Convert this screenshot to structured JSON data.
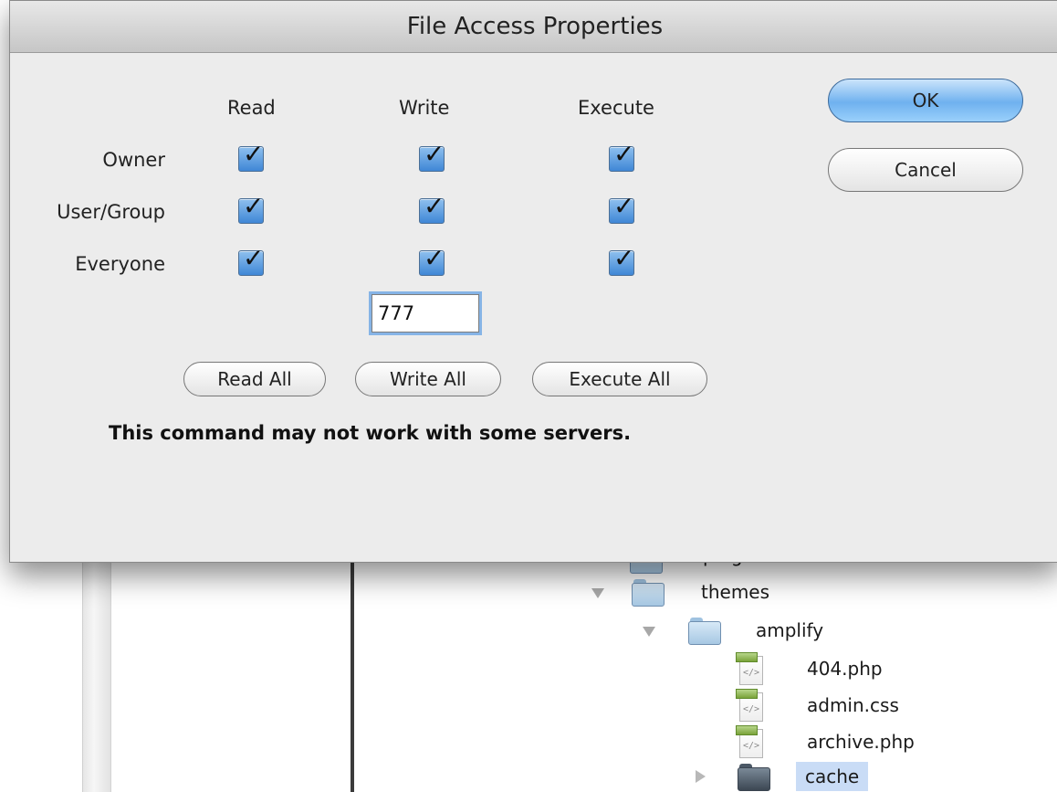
{
  "dialog": {
    "title": "File Access Properties",
    "columns": [
      "Read",
      "Write",
      "Execute"
    ],
    "rows": [
      {
        "label": "Owner",
        "read": true,
        "write": true,
        "execute": true
      },
      {
        "label": "User/Group",
        "read": true,
        "write": true,
        "execute": true
      },
      {
        "label": "Everyone",
        "read": true,
        "write": true,
        "execute": true
      }
    ],
    "octal_value": "777",
    "read_all_label": "Read All",
    "write_all_label": "Write All",
    "execute_all_label": "Execute All",
    "warning": "This command may not work with some servers.",
    "ok_label": "OK",
    "cancel_label": "Cancel",
    "accent_color": "#6fb1ef"
  },
  "file_tree": {
    "items": [
      {
        "name": "plugins",
        "type": "folder",
        "expanded": false
      },
      {
        "name": "themes",
        "type": "folder",
        "expanded": true
      },
      {
        "name": "amplify",
        "type": "folder",
        "expanded": true
      },
      {
        "name": "404.php",
        "type": "file"
      },
      {
        "name": "admin.css",
        "type": "file"
      },
      {
        "name": "archive.php",
        "type": "file"
      },
      {
        "name": "cache",
        "type": "folder",
        "expanded": false,
        "selected": true
      }
    ]
  }
}
